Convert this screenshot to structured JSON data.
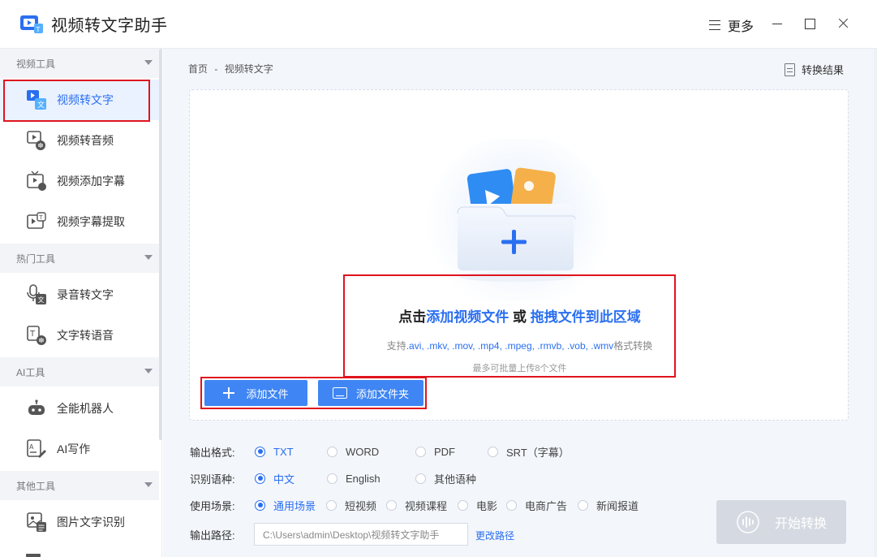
{
  "app": {
    "title": "视频转文字助手",
    "more_label": "更多"
  },
  "sidebar": {
    "sections": [
      {
        "title": "视频工具",
        "items": [
          {
            "label": "视频转文字",
            "icon": "video-to-text-icon"
          },
          {
            "label": "视频转音频",
            "icon": "video-to-audio-icon"
          },
          {
            "label": "视频添加字幕",
            "icon": "video-add-subtitle-icon"
          },
          {
            "label": "视频字幕提取",
            "icon": "subtitle-extract-icon"
          }
        ]
      },
      {
        "title": "热门工具",
        "items": [
          {
            "label": "录音转文字",
            "icon": "mic-text-icon"
          },
          {
            "label": "文字转语音",
            "icon": "text-to-speech-icon"
          }
        ]
      },
      {
        "title": "AI工具",
        "items": [
          {
            "label": "全能机器人",
            "icon": "robot-icon"
          },
          {
            "label": "AI写作",
            "icon": "ai-write-icon"
          }
        ]
      },
      {
        "title": "其他工具",
        "items": [
          {
            "label": "图片文字识别",
            "icon": "image-ocr-icon"
          }
        ]
      }
    ]
  },
  "breadcrumb": {
    "home": "首页",
    "sep": "-",
    "current": "视频转文字"
  },
  "result_link": "转换结果",
  "dropzone": {
    "prefix": "点击",
    "add_link": "添加视频文件",
    "or": " 或 ",
    "drag_link": "拖拽文件到此区域",
    "support_prefix": "支持",
    "formats": ".avi, .mkv, .mov, .mp4, .mpeg, .rmvb, .vob, .wmv",
    "support_suffix": "格式转换",
    "limit": "最多可批量上传8个文件"
  },
  "buttons": {
    "add_file": "添加文件",
    "add_folder": "添加文件夹",
    "start": "开始转换"
  },
  "options": {
    "format_label": "输出格式:",
    "formats": [
      "TXT",
      "WORD",
      "PDF",
      "SRT（字幕）"
    ],
    "format_selected": "TXT",
    "language_label": "识别语种:",
    "languages": [
      "中文",
      "English",
      "其他语种"
    ],
    "language_selected": "中文",
    "scene_label": "使用场景:",
    "scenes": [
      "通用场景",
      "短视频",
      "视频课程",
      "电影",
      "电商广告",
      "新闻报道"
    ],
    "scene_selected": "通用场景",
    "path_label": "输出路径:",
    "path_value": "C:\\Users\\admin\\Desktop\\视频转文字助手",
    "change_path": "更改路径"
  },
  "colors": {
    "accent": "#2a6ff0",
    "button": "#3f86f4",
    "highlight": "#e0141e"
  }
}
